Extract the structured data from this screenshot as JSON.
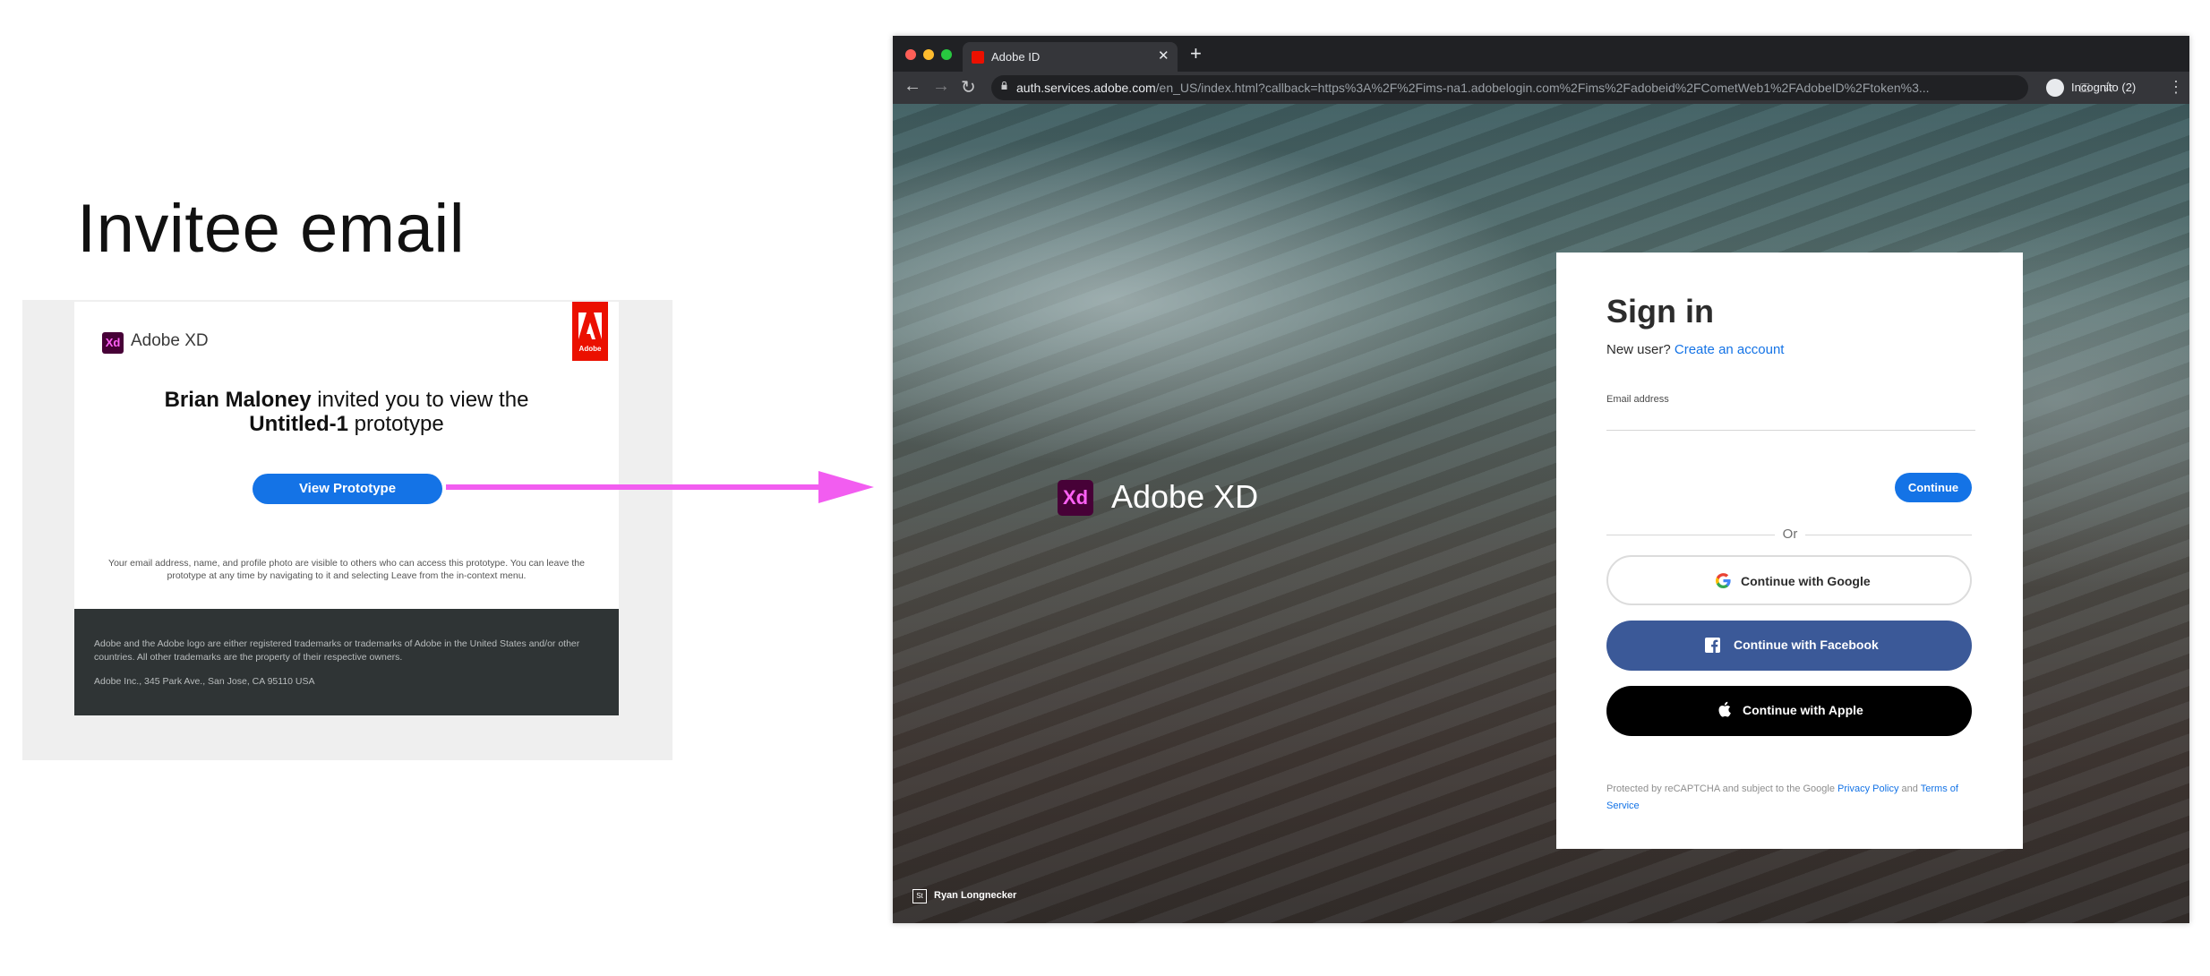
{
  "left_panel": {
    "heading": "Invitee email",
    "email": {
      "brand_logo_text": "Xd",
      "brand_name": "Adobe XD",
      "adobe_tag_text": "Adobe",
      "inviter_name": "Brian Maloney",
      "invite_mid": " invited you to view the",
      "prototype_name": "Untitled-1",
      "invite_end": " prototype",
      "button_label": "View Prototype",
      "privacy_note": "Your email address, name, and profile photo are visible to others who can access this prototype. You can leave the prototype at any time by navigating to it and selecting Leave from the in-context menu.",
      "footer_legal": "Adobe and the Adobe logo are either registered trademarks or trademarks of Adobe in the United States and/or other countries. All other trademarks are the property of their respective owners.",
      "footer_address": "Adobe Inc., 345 Park Ave., San Jose, CA 95110 USA"
    },
    "arrow_color": "#f25df0"
  },
  "browser": {
    "tab_title": "Adobe ID",
    "url_host": "auth.services.adobe.com",
    "url_path": "/en_US/index.html?callback=https%3A%2F%2Fims-na1.adobelogin.com%2Fims%2Fadobeid%2FCometWeb1%2FAdobeID%2Ftoken%3...",
    "incognito_label": "Incognito (2)",
    "traffic_lights": [
      "#ff5f57",
      "#febc2e",
      "#28c840"
    ]
  },
  "page": {
    "xd_logo_text": "Xd",
    "xd_name": "Adobe XD",
    "photo_icon_text": "St",
    "photo_credit": "Ryan Longnecker",
    "signin": {
      "title": "Sign in",
      "new_user": "New user?",
      "create_account": "Create an account",
      "email_label": "Email address",
      "email_value": "",
      "continue_label": "Continue",
      "or_label": "Or",
      "google_label": "Continue with Google",
      "facebook_label": "Continue with Facebook",
      "apple_label": "Continue with Apple",
      "recaptcha_pre": "Protected by reCAPTCHA and subject to the Google ",
      "privacy_policy": "Privacy Policy",
      "recaptcha_and": " and ",
      "terms": "Terms of Service"
    }
  },
  "colors": {
    "accent": "#1473e6",
    "adobe_red": "#eb1000",
    "xd_purple": "#470137",
    "xd_pink": "#ff61f6",
    "facebook": "#3b5998"
  }
}
